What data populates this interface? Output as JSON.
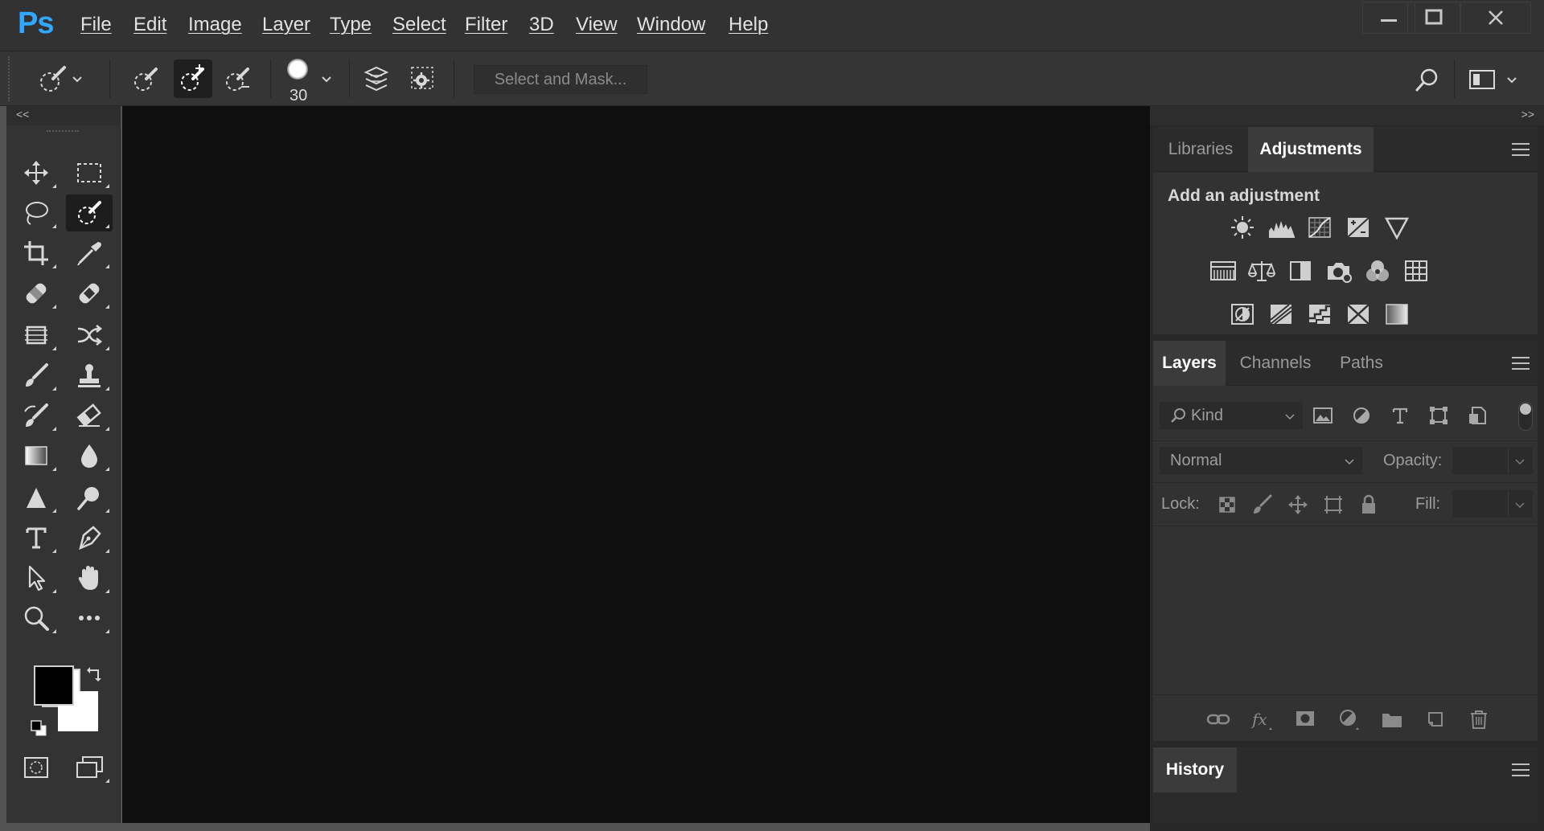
{
  "app": {
    "logo": "Ps"
  },
  "menu": {
    "items": [
      "File",
      "Edit",
      "Image",
      "Layer",
      "Type",
      "Select",
      "Filter",
      "3D",
      "View",
      "Window",
      "Help"
    ]
  },
  "window_controls": {
    "minimize_icon": "minimize-icon",
    "maximize_icon": "maximize-icon",
    "close_icon": "close-icon"
  },
  "options": {
    "brush_size": "30",
    "select_mask_label": "Select and Mask..."
  },
  "panels": {
    "collapse_left": "<<",
    "collapse_right": ">>",
    "top_tabs": [
      "Libraries",
      "Adjustments"
    ],
    "active_top_tab": "Adjustments",
    "adjustments_heading": "Add an adjustment",
    "layer_tabs": [
      "Layers",
      "Channels",
      "Paths"
    ],
    "active_layer_tab": "Layers",
    "kind_label": "Kind",
    "blend_mode": "Normal",
    "opacity_label": "Opacity:",
    "lock_label": "Lock:",
    "fill_label": "Fill:",
    "history_tab": "History"
  },
  "colors": {
    "foreground": "#000000",
    "background": "#ffffff",
    "accent": "#31a8ff"
  }
}
